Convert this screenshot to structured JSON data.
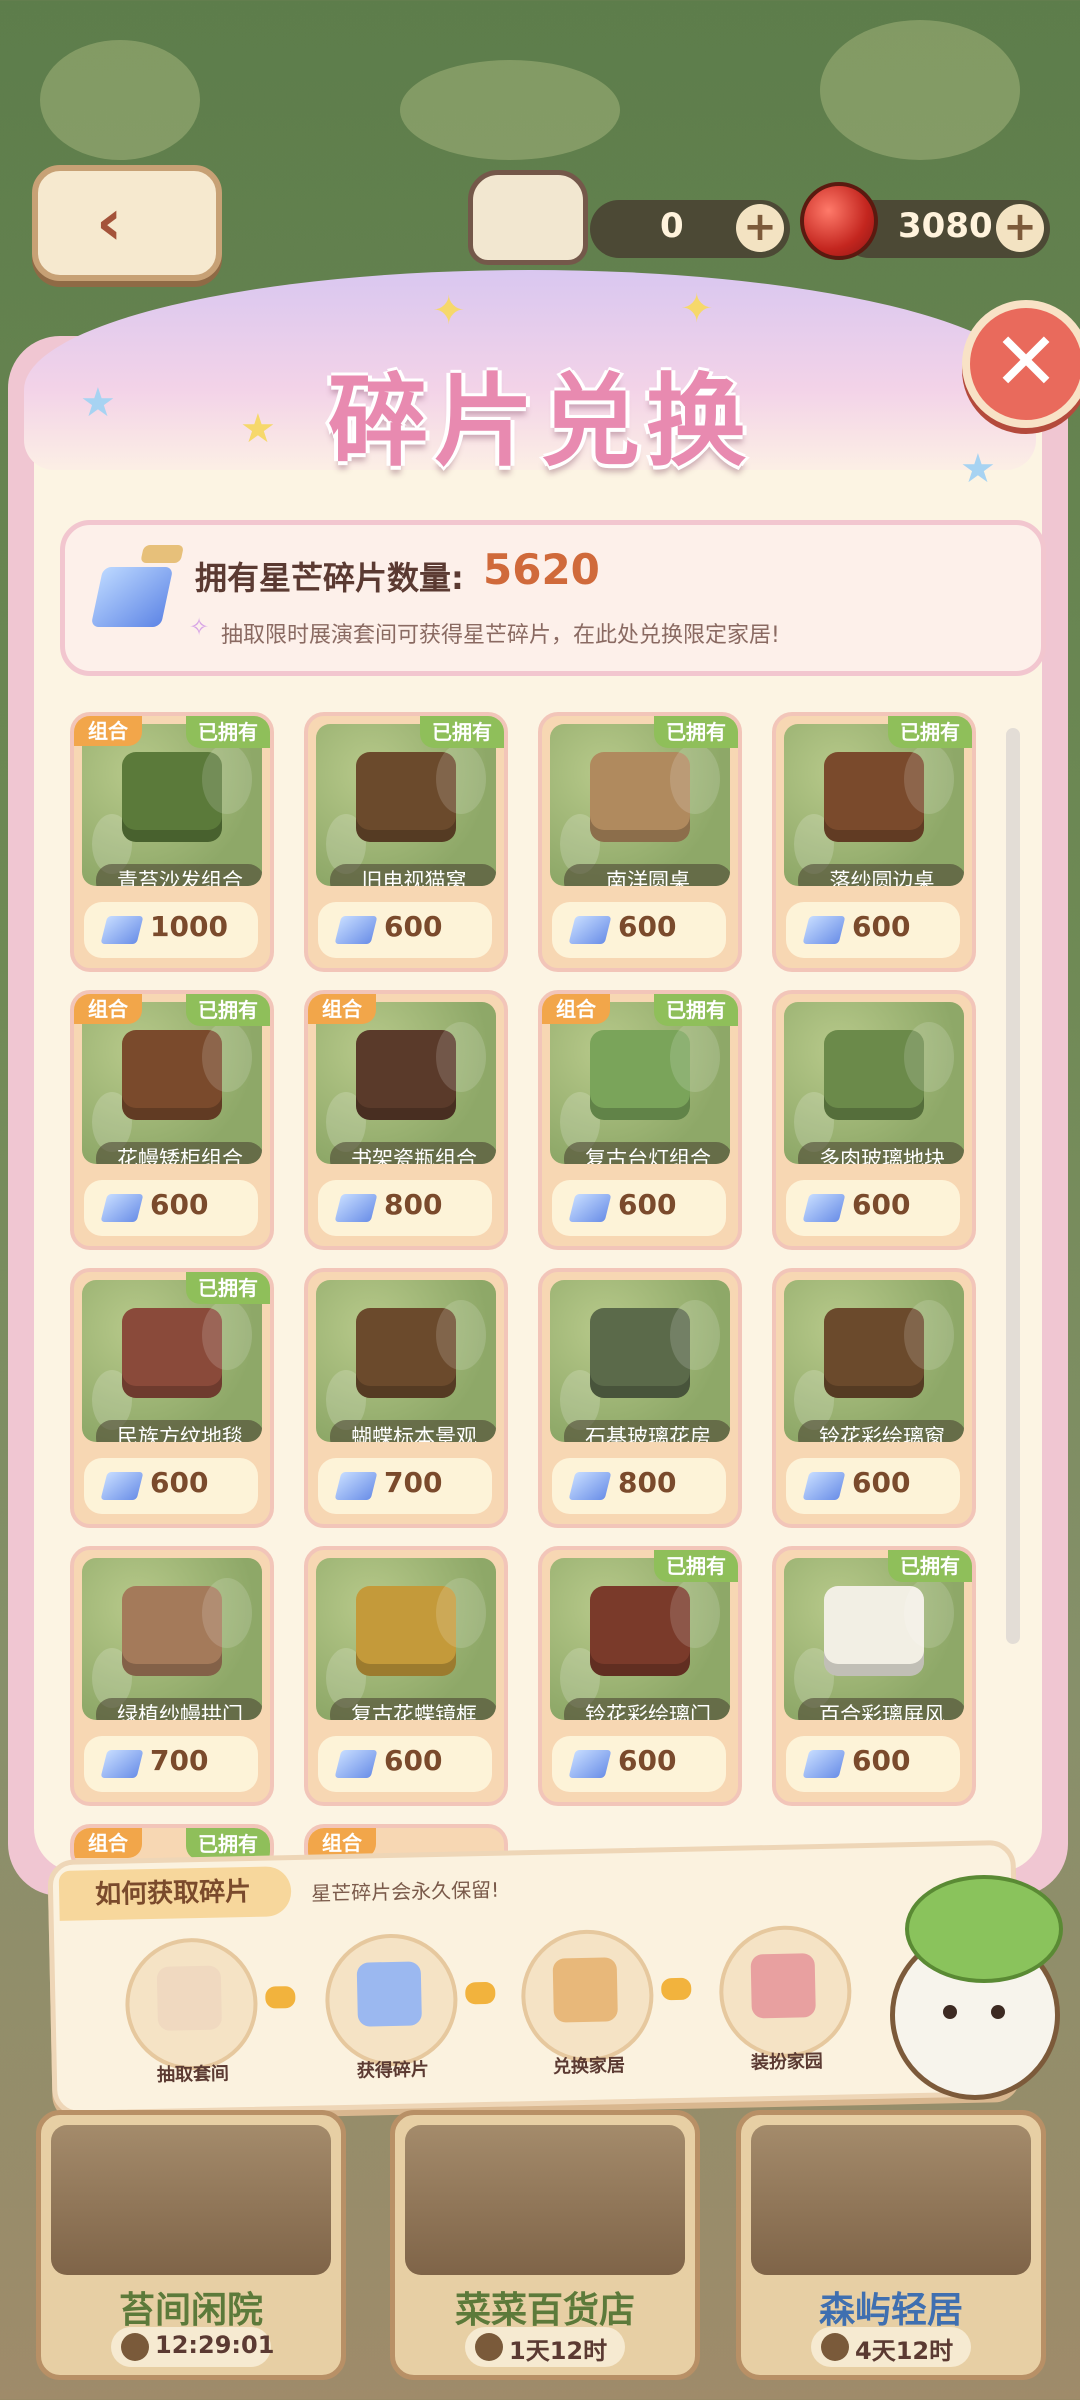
{
  "topbar": {
    "currency1_value": "0",
    "currency2_value": "3080",
    "plus_symbol": "+"
  },
  "panel": {
    "title": "碎片兑换",
    "info": {
      "label": "拥有星芒碎片数量:",
      "count": "5620",
      "hint": "抽取限时展演套间可获得星芒碎片，在此处兑换限定家居!"
    }
  },
  "items": [
    {
      "name": "青苔沙发组合",
      "price": "1000",
      "combo": "组合",
      "owned": "已拥有",
      "color": "#5b7a3a"
    },
    {
      "name": "旧电视猫窝",
      "price": "600",
      "combo": "",
      "owned": "已拥有",
      "color": "#6b4a2c"
    },
    {
      "name": "南洋圆桌",
      "price": "600",
      "combo": "",
      "owned": "已拥有",
      "color": "#b08a5e"
    },
    {
      "name": "落纱圆边桌",
      "price": "600",
      "combo": "",
      "owned": "已拥有",
      "color": "#7a4a2c"
    },
    {
      "name": "花幔矮柜组合",
      "price": "600",
      "combo": "组合",
      "owned": "已拥有",
      "color": "#7a4a2c"
    },
    {
      "name": "书架瓷瓶组合",
      "price": "800",
      "combo": "组合",
      "owned": "",
      "color": "#5a3a2a"
    },
    {
      "name": "复古台灯组合",
      "price": "600",
      "combo": "组合",
      "owned": "已拥有",
      "color": "#7aa45a"
    },
    {
      "name": "多肉玻璃地块",
      "price": "600",
      "combo": "",
      "owned": "",
      "color": "#6b8a4a"
    },
    {
      "name": "民族方纹地毯",
      "price": "600",
      "combo": "",
      "owned": "已拥有",
      "color": "#8a4a3a"
    },
    {
      "name": "蝴蝶标本景观",
      "price": "700",
      "combo": "",
      "owned": "",
      "color": "#6b4a2c"
    },
    {
      "name": "石基玻璃花房",
      "price": "800",
      "combo": "",
      "owned": "",
      "color": "#5b6a4a"
    },
    {
      "name": "铃花彩绘璃窗",
      "price": "600",
      "combo": "",
      "owned": "",
      "color": "#6b4a2c"
    },
    {
      "name": "绿植纱幔拱门",
      "price": "700",
      "combo": "",
      "owned": "",
      "color": "#a47a5a"
    },
    {
      "name": "复古花蝶镜框",
      "price": "600",
      "combo": "",
      "owned": "",
      "color": "#c49a3a"
    },
    {
      "name": "铃花彩绘璃门",
      "price": "600",
      "combo": "",
      "owned": "已拥有",
      "color": "#7a3a2a"
    },
    {
      "name": "百合彩璃屏风",
      "price": "600",
      "combo": "",
      "owned": "已拥有",
      "color": "#f2efe4"
    }
  ],
  "partial_row": [
    {
      "combo": "组合",
      "owned": "已拥有"
    },
    {
      "combo": "组合",
      "owned": ""
    }
  ],
  "guide": {
    "heading": "如何获取碎片",
    "note": "星芒碎片会永久保留!",
    "steps": [
      {
        "label": "抽取套间",
        "color": "#f0d9c0"
      },
      {
        "label": "获得碎片",
        "color": "#9bb8f0"
      },
      {
        "label": "兑换家居",
        "color": "#e8b87a"
      },
      {
        "label": "装扮家园",
        "color": "#e8a0a0"
      }
    ]
  },
  "shops": [
    {
      "name": "苔间闲院",
      "time": "12:29:01"
    },
    {
      "name": "菜菜百货店",
      "time": "1天12时"
    },
    {
      "name": "森屿轻居",
      "time": "4天12时"
    }
  ]
}
